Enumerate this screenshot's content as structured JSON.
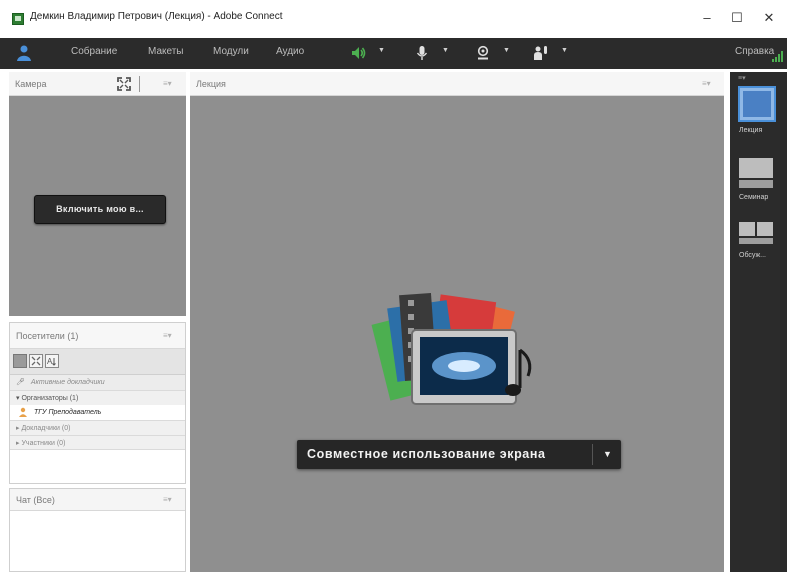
{
  "window": {
    "title": "Демкин Владимир Петрович (Лекция) - Adobe Connect",
    "minimize": "–",
    "maximize": "☐",
    "close": "✕"
  },
  "menu": {
    "items": [
      "Собрание",
      "Макеты",
      "Модули",
      "Аудио"
    ],
    "help": "Справка"
  },
  "camera_pod": {
    "title": "Камера",
    "enable_button": "Включить мою в..."
  },
  "attendees_pod": {
    "title": "Посетители (1)",
    "active_speakers": "Активные докладчики",
    "groups": [
      {
        "label": "Организаторы (1)",
        "expanded": true,
        "members": [
          "ТГУ Преподаватель"
        ]
      },
      {
        "label": "Докладчики (0)",
        "expanded": false,
        "members": []
      },
      {
        "label": "Участники (0)",
        "expanded": false,
        "members": []
      }
    ]
  },
  "chat_pod": {
    "title": "Чат (Все)"
  },
  "stage": {
    "title": "Лекция",
    "share_button": "Совместное использование экрана"
  },
  "layouts": [
    {
      "label": "Лекция",
      "active": true
    },
    {
      "label": "Семинар",
      "active": false
    },
    {
      "label": "Обсуж...",
      "active": false
    }
  ],
  "colors": {
    "menubar": "#2b2b2b",
    "stage": "#8f8f8f",
    "accent_green": "#4caf50",
    "active_layout": "#4a90d9"
  }
}
